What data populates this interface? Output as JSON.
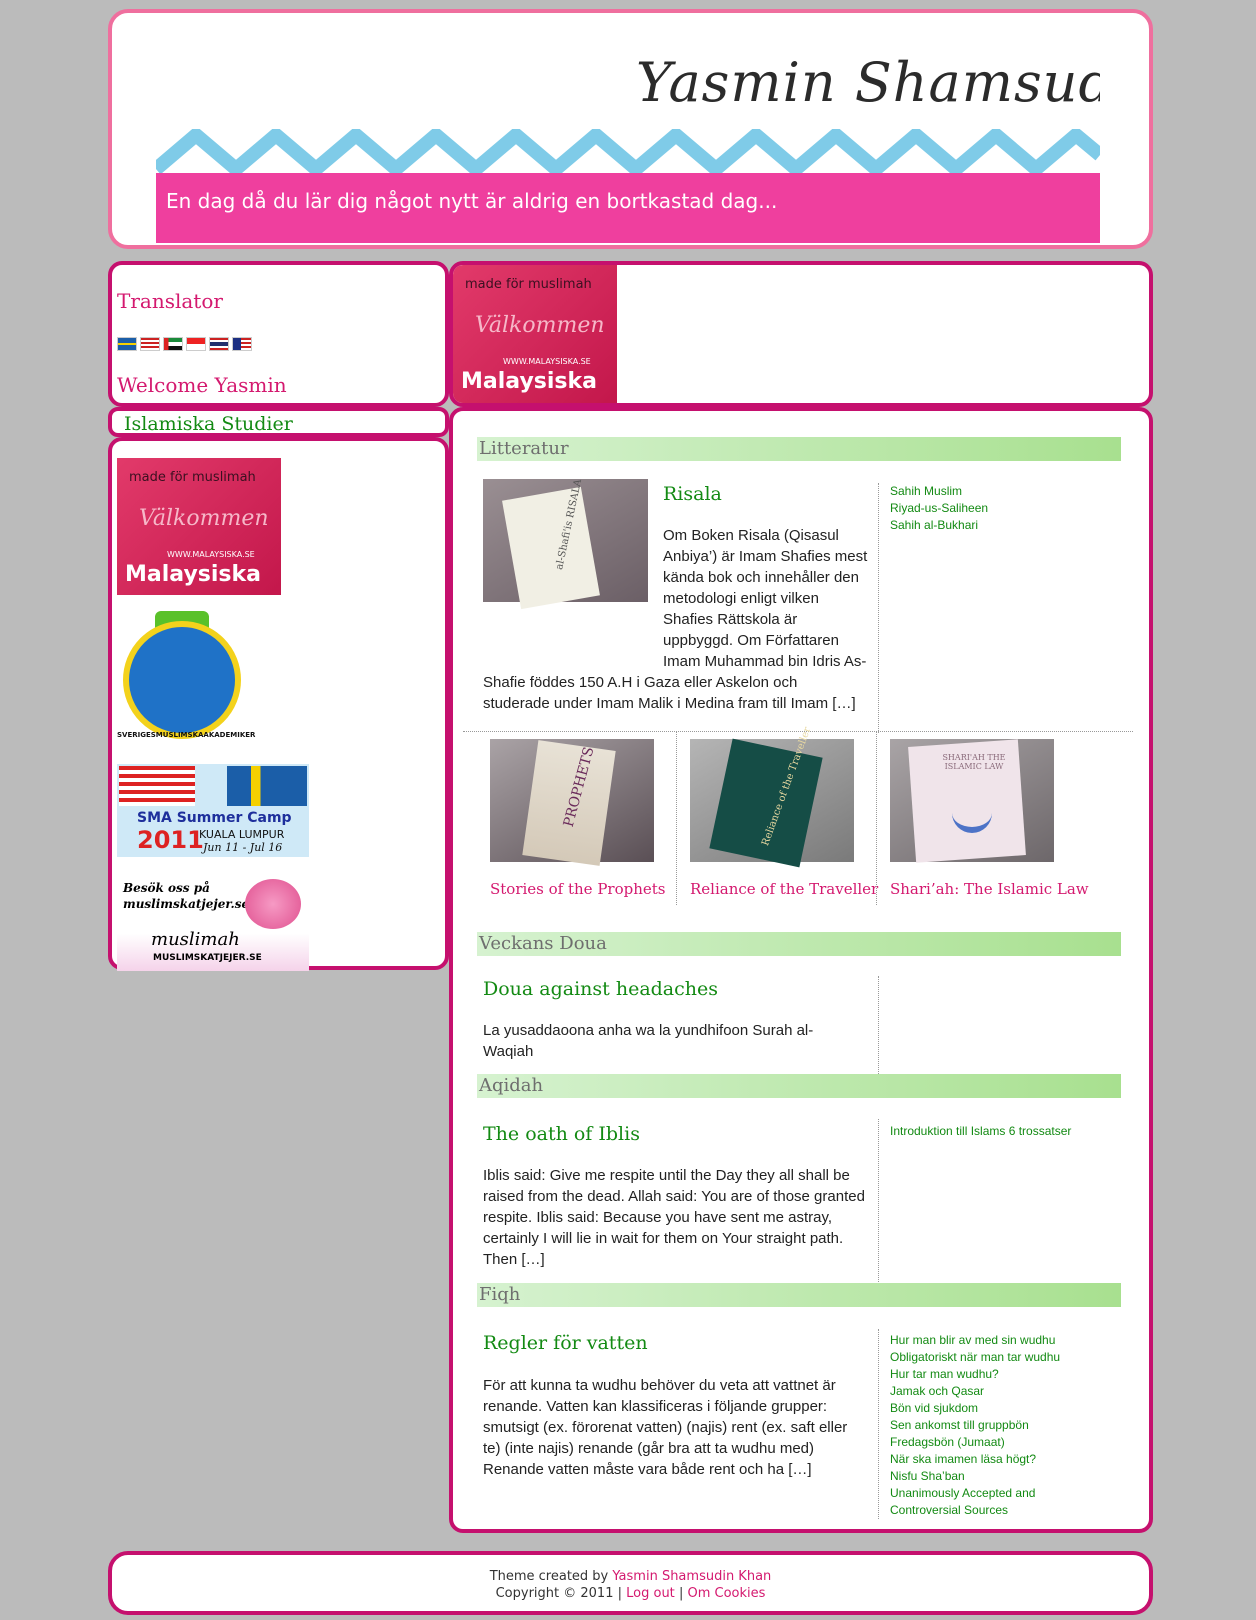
{
  "header": {
    "logo_script": "Yasmin Shamsudin",
    "tagline": "En dag då du lär dig något nytt är aldrig en bortkastad dag..."
  },
  "sidebar": {
    "translator_title": "Translator",
    "flags": [
      "sweden-flag-icon",
      "usa-flag-icon",
      "uae-flag-icon",
      "indonesia-flag-icon",
      "thailand-flag-icon",
      "malaysia-flag-icon"
    ],
    "welcome": "Welcome Yasmin",
    "nav_title": "Islamiska Studier",
    "banner_malaysiska": {
      "t1": "made för muslimah",
      "t2": "Välkommen",
      "t3": "WWW.MALAYSISKA.SE",
      "t4": "Malaysiska"
    },
    "badge_text": "SVERIGESMUSLIMSKAAKADEMIKER",
    "camp": {
      "title": "SMA Summer Camp",
      "year": "2011",
      "city": "KUALA LUMPUR",
      "dates": "Jun 11 - Jul 16"
    },
    "kat": {
      "line1": "Besök oss på",
      "line2": "muslimskatjejer.se",
      "brand": "muslimah",
      "site": "MUSLIMSKATJEJER.SE"
    }
  },
  "top_banner": {
    "t1": "made för muslimah",
    "t2": "Välkommen",
    "t3": "WWW.MALAYSISKA.SE",
    "t4": "Malaysiska"
  },
  "sections": [
    {
      "heading": "Litteratur",
      "post_title": "Risala",
      "post_body": "Om Boken Risala (Qisasul Anbiya’) är Imam Shafies mest kända bok och innehåller den metodologi enligt vilken Shafies Rättskola är uppbyggd. Om Författaren Imam Muhammad bin Idris As-Shafie föddes 150 A.H i Gaza eller Askelon och studerade under Imam Malik i Medina fram till Imam […]",
      "thumb_text": "al-Shafi'is RISALA",
      "links": [
        "Sahih Muslim",
        "Riyad-us-Saliheen",
        "Sahih al-Bukhari"
      ],
      "books": [
        {
          "title": "Stories of the Prophets",
          "cover": "PROPHETS"
        },
        {
          "title": "Reliance of the Traveller",
          "cover": "Reliance of the Traveller"
        },
        {
          "title": "Shari’ah: The Islamic Law",
          "cover": "SHARI'AH THE ISLAMIC LAW"
        }
      ]
    },
    {
      "heading": "Veckans Doua",
      "post_title": "Doua against headaches",
      "post_body": "La yusaddaoona anha wa la yundhifoon Surah al-Waqiah"
    },
    {
      "heading": "Aqidah",
      "post_title": "The oath of Iblis",
      "post_body": "Iblis said: Give me respite until the Day they all shall be raised from the dead. Allah said: You are of those granted respite. Iblis said: Because you have sent me astray, certainly I will lie in wait for them on Your straight path. Then […]",
      "links": [
        "Introduktion till Islams 6 trossatser"
      ]
    },
    {
      "heading": "Fiqh",
      "post_title": "Regler för vatten",
      "post_body": "För att kunna ta wudhu behöver du veta att vattnet är renande. Vatten kan klassificeras i följande grupper: smutsigt (ex. förorenat vatten) (najis) rent (ex. saft eller te) (inte najis) renande (går bra att ta wudhu med) Renande vatten måste vara både rent och ha […]",
      "links": [
        "Hur man blir av med sin wudhu",
        "Obligatoriskt när man tar wudhu",
        "Hur tar man wudhu?",
        "Jamak och Qasar",
        "Bön vid sjukdom",
        "Sen ankomst till gruppbön",
        "Fredagsbön (Jumaat)",
        "När ska imamen läsa högt?",
        "Nisfu Sha’ban",
        "Unanimously Accepted and",
        "Controversial Sources"
      ]
    }
  ],
  "footer": {
    "credit_prefix": "Theme created by",
    "credit_name": "Yasmin Shamsudin Khan",
    "copyright": "Copyright © 2011",
    "sep": "|",
    "logout": "Log out",
    "cookies": "Om Cookies"
  },
  "colors": {
    "accent": "#c5106e",
    "link_green": "#138a13",
    "header_border": "#ef6f9e",
    "background": "#bbbbbb"
  }
}
